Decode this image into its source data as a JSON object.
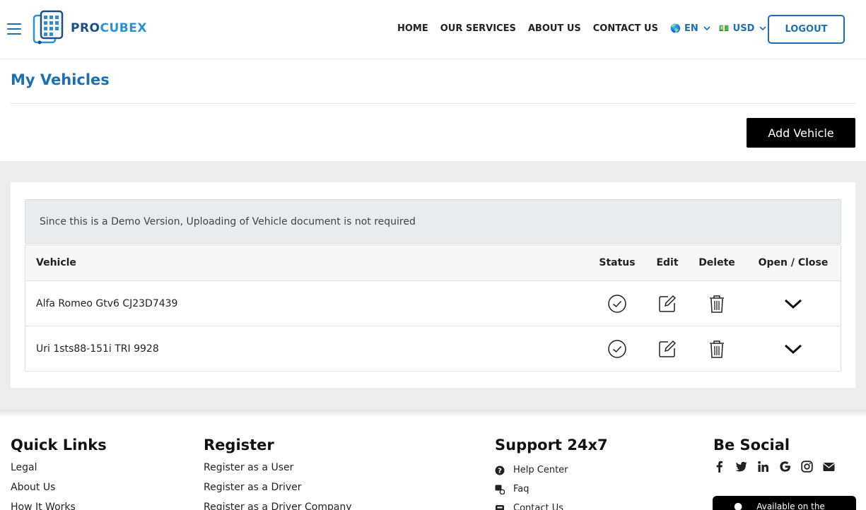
{
  "header": {
    "logo_part1": "PRO",
    "logo_part2": "CUBEX",
    "nav": [
      "HOME",
      "OUR SERVICES",
      "ABOUT US",
      "CONTACT US"
    ],
    "language": {
      "flag": "🌎",
      "label": "EN"
    },
    "currency": {
      "flag": "💵",
      "label": "USD"
    },
    "logout_label": "LOGOUT"
  },
  "page": {
    "title": "My Vehicles",
    "add_button": "Add Vehicle",
    "notice": "Since this is a Demo Version, Uploading of Vehicle document is not required"
  },
  "table": {
    "columns": {
      "vehicle": "Vehicle",
      "status": "Status",
      "edit": "Edit",
      "delete": "Delete",
      "open_close": "Open / Close"
    },
    "rows": [
      {
        "vehicle": "Alfa Romeo Gtv6 CJ23D7439"
      },
      {
        "vehicle": "Uri 1sts88-151i TRI 9928"
      }
    ]
  },
  "footer": {
    "quick_links": {
      "title": "Quick Links",
      "items": [
        "Legal",
        "About Us",
        "How It Works"
      ]
    },
    "register": {
      "title": "Register",
      "items": [
        "Register as a User",
        "Register as a Driver",
        "Register as a Driver Company"
      ]
    },
    "support": {
      "title": "Support 24x7",
      "items": [
        "Help Center",
        "Faq",
        "Contact Us"
      ]
    },
    "social": {
      "title": "Be Social",
      "icons": [
        "facebook-icon",
        "twitter-icon",
        "linkedin-icon",
        "google-icon",
        "instagram-icon",
        "envelope-icon"
      ]
    },
    "app_badge": "Available on the"
  },
  "colors": {
    "brand": "#1a6fb5",
    "brand_dark": "#1a4f8a",
    "button_dark": "#000000",
    "band": "#ededed"
  }
}
